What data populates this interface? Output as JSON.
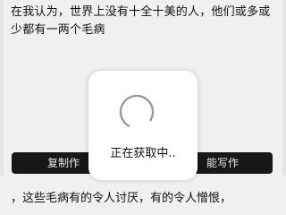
{
  "editor": {
    "top_text": "在我认为，世界上没有十全十美的人，他们或多或少都有一两个毛病",
    "bottom_text": "，这些毛病有的令人讨厌，有的令人憎恨，"
  },
  "actions": {
    "copy_label": "复制作",
    "smart_label": "能写作"
  },
  "loading": {
    "label": "正在获取中.."
  },
  "icons": {
    "spinner": "loading-spinner"
  }
}
